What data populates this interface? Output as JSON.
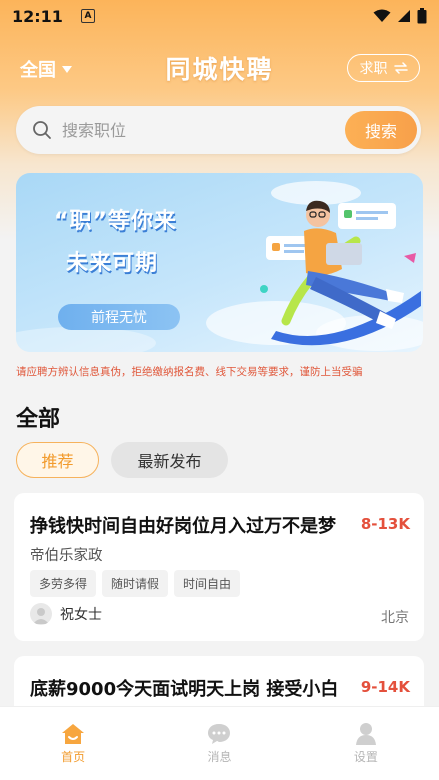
{
  "status_bar": {
    "time": "12:11",
    "indicator": "A"
  },
  "header": {
    "city": "全国",
    "app_title": "同城快聘",
    "job_seek_label": "求职",
    "job_seek_icon": "swap-icon"
  },
  "search": {
    "placeholder": "搜索职位",
    "button_label": "搜索"
  },
  "banner": {
    "line1": "“职”等你来",
    "line2": "未来可期",
    "pill": "前程无忧"
  },
  "disclaimer": "请应聘方辨认信息真伪，拒绝缴纳报名费、线下交易等要求，谨防上当受骗",
  "section": {
    "title": "全部",
    "tabs": [
      {
        "label": "推荐",
        "active": true
      },
      {
        "label": "最新发布",
        "active": false
      }
    ]
  },
  "jobs": [
    {
      "title": "挣钱快时间自由好岗位月入过万不是梦",
      "salary": "8-13K",
      "company": "帝伯乐家政",
      "tags": [
        "多劳多得",
        "随时请假",
        "时间自由"
      ],
      "poster": "祝女士",
      "location": "北京"
    },
    {
      "title": "底薪9000今天面试明天上岗 接受小白",
      "salary": "9-14K"
    }
  ],
  "bottom_nav": [
    {
      "label": "首页",
      "icon": "home-icon",
      "active": true
    },
    {
      "label": "消息",
      "icon": "message-icon",
      "active": false
    },
    {
      "label": "设置",
      "icon": "settings-icon",
      "active": false
    }
  ],
  "colors": {
    "accent": "#f29b2d",
    "salary": "#e4503c",
    "header_gradient_top": "#fcb45a",
    "disclaimer": "#e0573a"
  }
}
